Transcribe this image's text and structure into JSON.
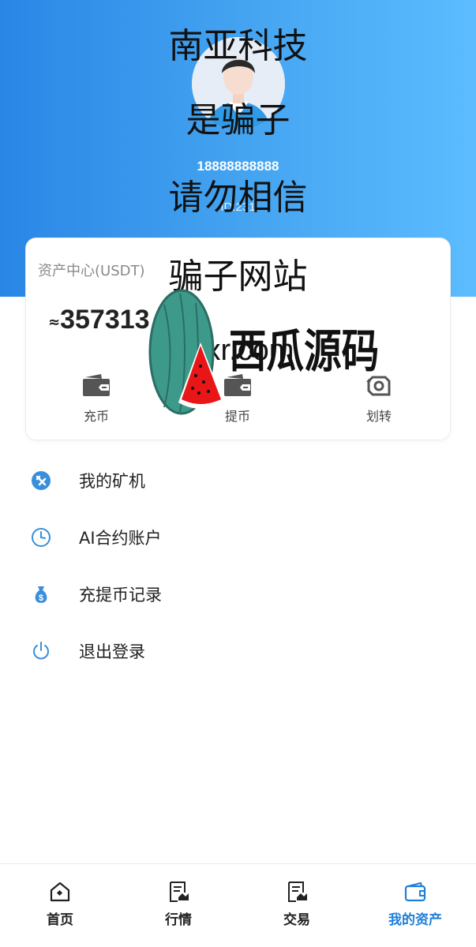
{
  "profile": {
    "phone": "18888888888",
    "sub": "ID:231"
  },
  "watermark": {
    "line1": "南亚科技",
    "line2": "是骗子",
    "line3": "请勿相信",
    "line4": "骗子网站",
    "domain": "xr.com",
    "brand": "西瓜源码"
  },
  "assets": {
    "title": "资产中心(USDT)",
    "approx": "≈",
    "balance": "357313"
  },
  "actions": [
    {
      "label": "充币",
      "icon": "wallet-deposit-icon"
    },
    {
      "label": "提币",
      "icon": "wallet-withdraw-icon"
    },
    {
      "label": "划转",
      "icon": "transfer-icon"
    }
  ],
  "menu": [
    {
      "label": "我的矿机",
      "icon": "miner-icon"
    },
    {
      "label": "AI合约账户",
      "icon": "clock-icon"
    },
    {
      "label": "充提币记录",
      "icon": "money-bag-icon"
    },
    {
      "label": "退出登录",
      "icon": "power-icon"
    }
  ],
  "tabs": [
    {
      "label": "首页",
      "icon": "home-icon"
    },
    {
      "label": "行情",
      "icon": "market-icon"
    },
    {
      "label": "交易",
      "icon": "trade-icon"
    },
    {
      "label": "我的资产",
      "icon": "wallet-icon"
    }
  ],
  "colors": {
    "header_start": "#2a86e6",
    "header_end": "#5cbcff",
    "accent": "#1f7fd8",
    "menu_icon": "#3a8fd9"
  }
}
